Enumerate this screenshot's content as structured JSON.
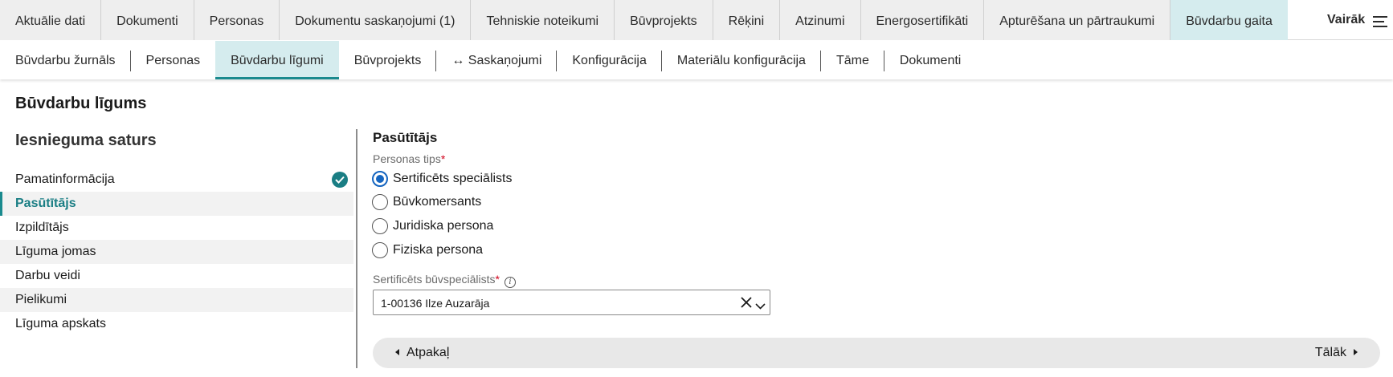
{
  "top_tabs": [
    {
      "label": "Aktuālie dati"
    },
    {
      "label": "Dokumenti"
    },
    {
      "label": "Personas"
    },
    {
      "label": "Dokumentu saskaņojumi (1)"
    },
    {
      "label": "Tehniskie noteikumi"
    },
    {
      "label": "Būvprojekts"
    },
    {
      "label": "Rēķini"
    },
    {
      "label": "Atzinumi"
    },
    {
      "label": "Energosertifikāti"
    },
    {
      "label": "Apturēšana un pārtraukumi"
    },
    {
      "label": "Būvdarbu gaita",
      "active": true
    }
  ],
  "more": {
    "label": "Vairāk",
    "icon": "menu-icon"
  },
  "sub_tabs": [
    {
      "label": "Būvdarbu žurnāls"
    },
    {
      "label": "Personas"
    },
    {
      "label": "Būvdarbu līgumi",
      "active": true
    },
    {
      "label": "Būvprojekts"
    },
    {
      "label": "↔ Saskaņojumi"
    },
    {
      "label": "Konfigurācija"
    },
    {
      "label": "Materiālu konfigurācija"
    },
    {
      "label": "Tāme"
    },
    {
      "label": "Dokumenti"
    }
  ],
  "page_title": "Būvdarbu līgums",
  "sidebar": {
    "title": "Iesnieguma saturs",
    "items": [
      {
        "label": "Pamatinformācija",
        "completed": true
      },
      {
        "label": "Pasūtītājs",
        "active": true
      },
      {
        "label": "Izpildītājs"
      },
      {
        "label": "Līguma jomas"
      },
      {
        "label": "Darbu veidi"
      },
      {
        "label": "Pielikumi"
      },
      {
        "label": "Līguma apskats"
      }
    ]
  },
  "form": {
    "section_title": "Pasūtītājs",
    "person_type": {
      "label": "Personas tips",
      "required_mark": "*",
      "options": [
        {
          "label": "Sertificēts speciālists",
          "selected": true
        },
        {
          "label": "Būvkomersants"
        },
        {
          "label": "Juridiska persona"
        },
        {
          "label": "Fiziska persona"
        }
      ]
    },
    "specialist": {
      "label": "Sertificēts būvspeciālists",
      "required_mark": "*",
      "value": "1-00136 Ilze Auzarāja"
    }
  },
  "pager": {
    "back_label": "Atpakaļ",
    "next_label": "Tālāk"
  },
  "colors": {
    "accent": "#1a8a8e",
    "active_tab_bg": "#d5ecee",
    "radio_selected": "#1565c0",
    "required": "#d0021b"
  }
}
